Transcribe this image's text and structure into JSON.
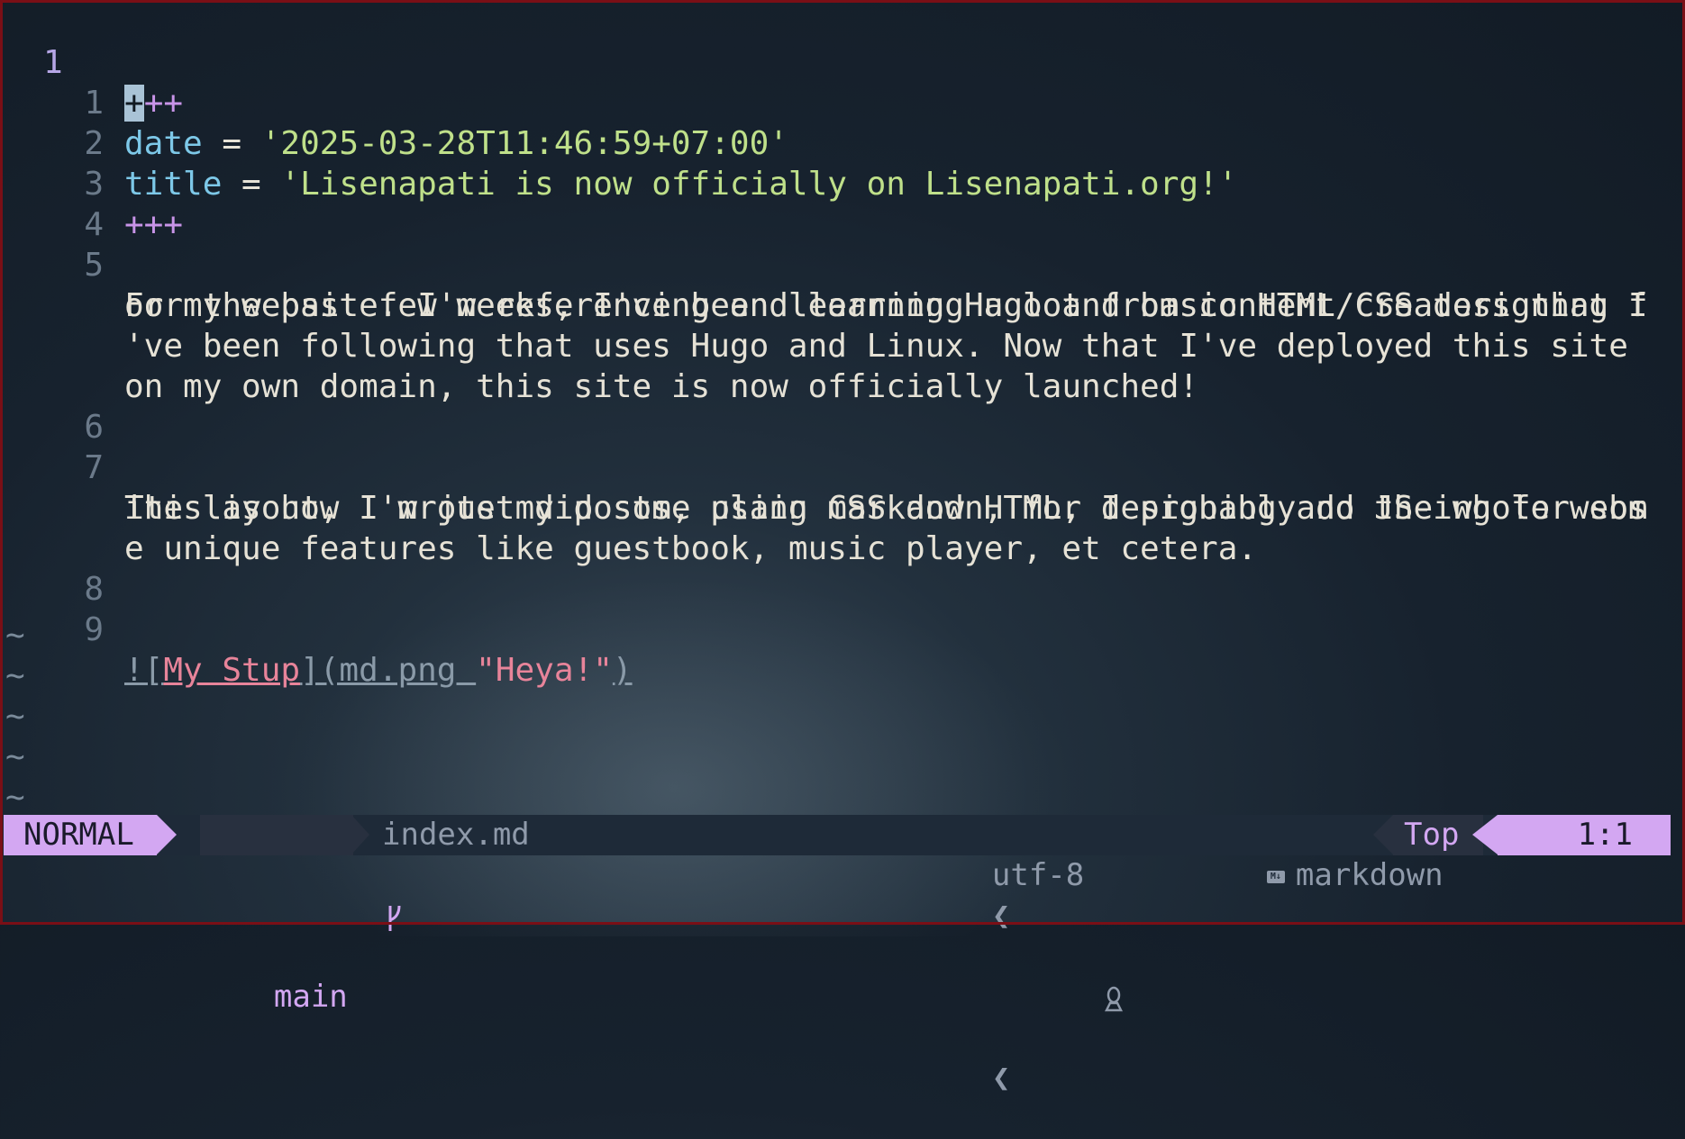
{
  "editor": {
    "current_line_number": "1",
    "line1": {
      "cursor_char": "+",
      "rest": "++"
    },
    "lines": [
      {
        "num": "1",
        "key": "date",
        "eq": " = ",
        "value": "'2025-03-28T11:46:59+07:00'"
      },
      {
        "num": "2",
        "key": "title",
        "eq": " = ",
        "value": "'Lisenapati is now officially on Lisenapati.org!'"
      },
      {
        "num": "3",
        "delim": "+++"
      },
      {
        "num": "4"
      },
      {
        "num": "5",
        "wrapped": [
          "For the past few weeks, I've been learning Hugo and basic HTML/CSS designing f",
          "or my website. I'm referencing and learning a lot from content creators that I",
          "'ve been following that uses Hugo and Linux. Now that I've deployed this site ",
          "on my own domain, this site is now officially launched!"
        ]
      },
      {
        "num": "6"
      },
      {
        "num": "7",
        "wrapped": [
          "This is how I wrote my posts, using markdown, for designing and the whole webs",
          "ite layout, I'm just did some plain CSS and HTML, I probably do JS-ing for som",
          "e unique features like guestbook, music player, et cetera."
        ]
      },
      {
        "num": "8"
      },
      {
        "num": "9",
        "image": {
          "bang": "![",
          "alt": "My Stup",
          "mid": "](md.png ",
          "title": "\"Heya!\"",
          "close": ")"
        }
      }
    ],
    "tilde": "~"
  },
  "statusbar": {
    "mode": "NORMAL",
    "branch_icon": "git-branch-icon",
    "branch": "main",
    "filename": "index.md",
    "encoding": "utf-8",
    "sep": "❮",
    "os_icon": "linux-tux-icon",
    "filetype_icon": "markdown-icon",
    "filetype": "markdown",
    "scroll": "Top",
    "position": "1:1"
  },
  "colors": {
    "accent": "#d3a7f2",
    "key": "#7dc8e8",
    "string": "#bfe08a",
    "link": "#e8849a"
  }
}
